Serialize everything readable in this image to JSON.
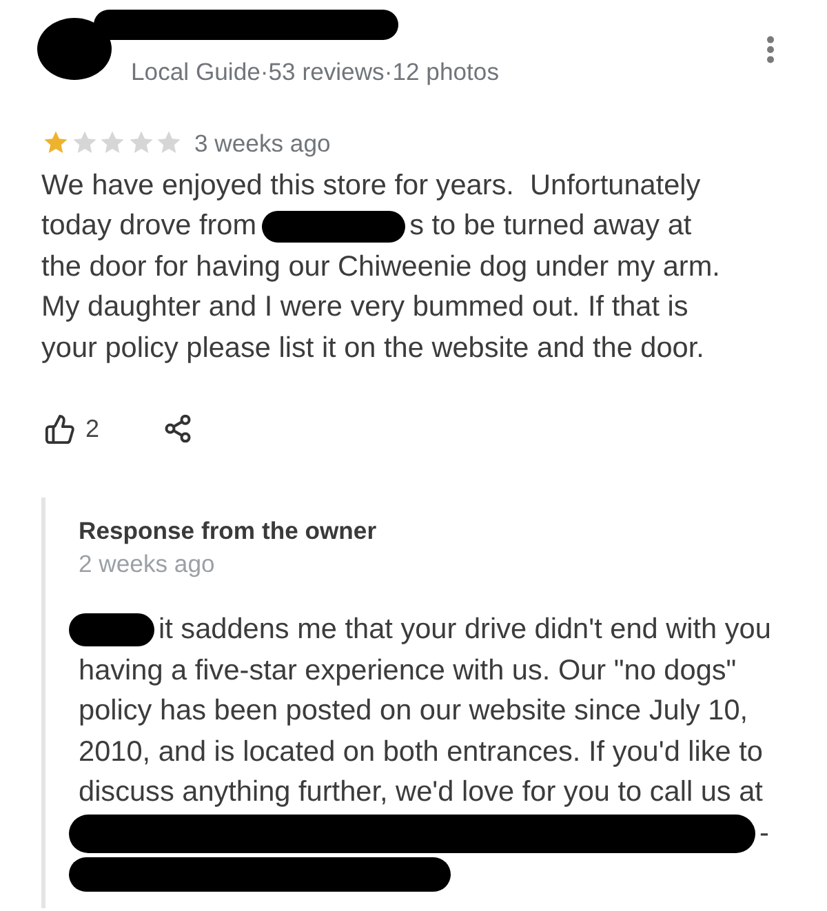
{
  "reviewer": {
    "avatar": {
      "kind": "redaction"
    },
    "name": {
      "kind": "redaction"
    },
    "meta": "Local Guide·53 reviews·12 photos"
  },
  "review": {
    "stars": 1,
    "time": "3 weeks ago",
    "lines": [
      [
        {
          "kind": "text",
          "text": "We have enjoyed this store for years.  Unfortunately"
        }
      ],
      [
        {
          "kind": "text",
          "text": "today drove from"
        },
        {
          "kind": "redaction"
        },
        {
          "kind": "text",
          "text": "s to be turned away at"
        }
      ],
      [
        {
          "kind": "text",
          "text": "the door for having our Chiweenie dog under my arm."
        }
      ],
      [
        {
          "kind": "text",
          "text": "My daughter and I were very bummed out. If that is"
        }
      ],
      [
        {
          "kind": "text",
          "text": "your policy please list it on the website and the door."
        }
      ]
    ],
    "likes": "2"
  },
  "owner_response": {
    "title": "Response from the owner",
    "time": "2 weeks ago",
    "lines": [
      [
        {
          "kind": "redaction"
        },
        {
          "kind": "text",
          "text": "it saddens me that your drive didn't end with you"
        }
      ],
      [
        {
          "kind": "text",
          "text": "having a five-star experience with us. Our \"no dogs\""
        }
      ],
      [
        {
          "kind": "text",
          "text": "policy has been posted on our website since July 10,"
        }
      ],
      [
        {
          "kind": "text",
          "text": "2010, and is located on both entrances. If you'd like to"
        }
      ],
      [
        {
          "kind": "text",
          "text": "discuss anything further, we'd love for you to call us at"
        }
      ],
      [
        {
          "kind": "redaction"
        },
        {
          "kind": "text",
          "text": "-"
        }
      ],
      [
        {
          "kind": "redaction"
        }
      ]
    ]
  }
}
